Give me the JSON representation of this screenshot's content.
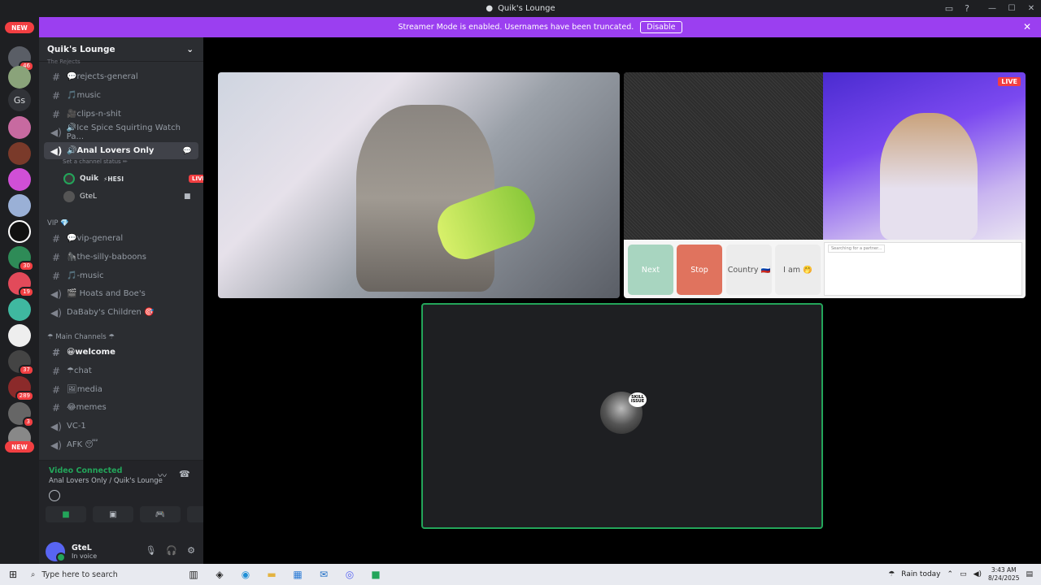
{
  "window": {
    "title": "Quik's Lounge"
  },
  "banner": {
    "text": "Streamer Mode is enabled. Usernames have been truncated.",
    "disable_label": "Disable"
  },
  "guilds": {
    "new_label": "NEW",
    "badges": [
      "46",
      "30",
      "19",
      "37",
      "289",
      "3"
    ],
    "gs_label": "Gs"
  },
  "server": {
    "name": "Quik's Lounge",
    "categories": {
      "rejects": "The Rejects",
      "vip": "VIP 💎",
      "main": "☂ Main Channels ☂"
    },
    "channels": [
      {
        "label": "💬rejects-general"
      },
      {
        "label": "🎵music"
      },
      {
        "label": "🎥clips-n-shit"
      },
      {
        "label": "🔊Ice Spice Squirting Watch Pa..."
      },
      {
        "label": "🔊Anal Lovers Only"
      },
      {
        "label": "💬vip-general"
      },
      {
        "label": "🦍the-silly-baboons"
      },
      {
        "label": "🎵-music"
      },
      {
        "label": "🎬 Hoats and Boe's"
      },
      {
        "label": "DaBaby's Children 🎯"
      },
      {
        "label": "😀welcome"
      },
      {
        "label": "☂chat"
      },
      {
        "label": "🖼media"
      },
      {
        "label": "😂memes"
      },
      {
        "label": "VC-1"
      },
      {
        "label": "AFK 😴"
      }
    ],
    "channel_status": "Set a channel status ✏",
    "voice_users": [
      {
        "name": "Quik",
        "tag": "⚡HESI",
        "live": "LIVE"
      },
      {
        "name": "GteL"
      }
    ]
  },
  "voice": {
    "status": "Video Connected",
    "location": "Anal Lovers Only / Quik's Lounge"
  },
  "user": {
    "name": "GteL",
    "status": "In voice"
  },
  "stream": {
    "live_label": "LIVE",
    "buttons": {
      "next": "Next",
      "stop": "Stop",
      "country": "Country 🇷🇺",
      "iam": "I am 🤭"
    },
    "chat_msg": "Searching for a partner...",
    "pfp_tag": "SKILL ISSUE"
  },
  "taskbar": {
    "search_placeholder": "Type here to search",
    "weather": "Rain today",
    "time": "3:43 AM",
    "date": "8/24/2025"
  }
}
